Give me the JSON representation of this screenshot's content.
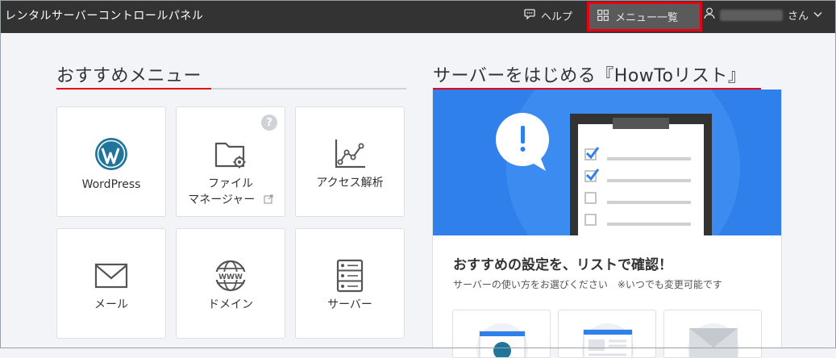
{
  "header": {
    "brand": "レンタルサーバーコントロールパネル",
    "help_label": "ヘルプ",
    "menu_label": "メニュー一覧",
    "user_suffix": "さん"
  },
  "recommended": {
    "title": "おすすめメニュー",
    "tiles": [
      {
        "label": "WordPress",
        "icon": "wordpress-icon"
      },
      {
        "label_line1": "ファイル",
        "label_line2": "マネージャー",
        "icon": "folder-gear-icon",
        "help": "?"
      },
      {
        "label": "アクセス解析",
        "icon": "line-chart-icon"
      },
      {
        "label": "メール",
        "icon": "envelope-icon"
      },
      {
        "label": "ドメイン",
        "icon": "globe-www-icon"
      },
      {
        "label": "サーバー",
        "icon": "server-icon"
      }
    ]
  },
  "howto": {
    "title": "サーバーをはじめる『HowToリスト』",
    "card_title": "おすすめの設定を、リストで確認！",
    "card_sub": "サーバーの使い方をお選びください　※いつでも変更可能です"
  },
  "colors": {
    "accent": "#e60012",
    "header_bg": "#333333",
    "hero_bg": "#2f80ea"
  }
}
